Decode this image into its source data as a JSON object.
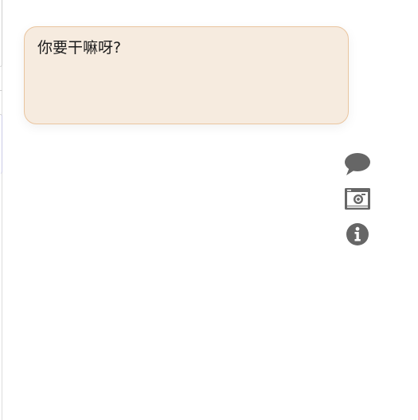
{
  "bubble": {
    "text": "你要干嘛呀?"
  },
  "toolbar": {
    "icons": [
      "comment-icon",
      "camera-icon",
      "info-icon"
    ]
  },
  "colors": {
    "bubble_bg": "#f6ebdf",
    "bubble_border": "#eac59f",
    "icon": "#666666"
  }
}
